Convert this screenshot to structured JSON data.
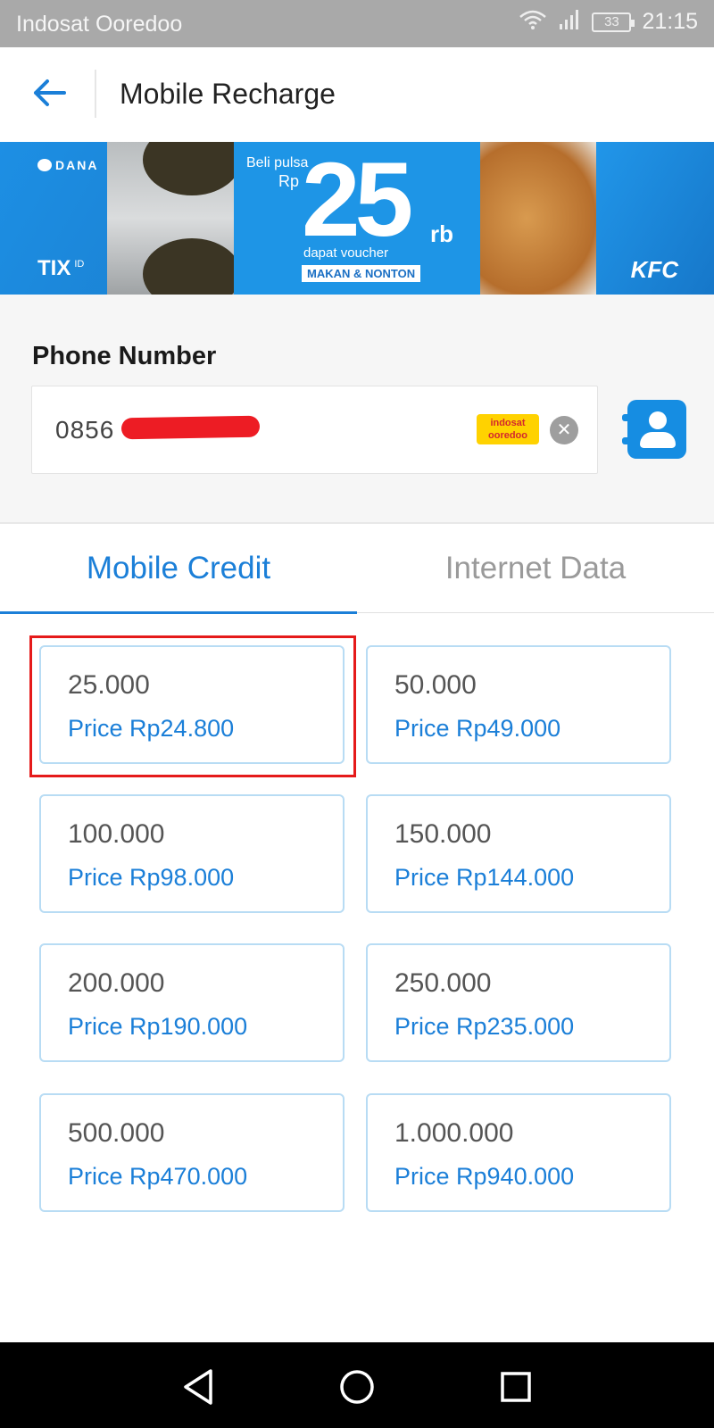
{
  "status_bar": {
    "carrier": "Indosat Ooredoo",
    "battery": "33",
    "time": "21:15"
  },
  "app_bar": {
    "title": "Mobile Recharge"
  },
  "banner": {
    "brand_left": "DANA",
    "brand_left_bottom": "TIX",
    "brand_left_bottom_sup": "ID",
    "line1": "Beli pulsa",
    "currency": "Rp",
    "amount": "25",
    "unit": "rb",
    "line2": "dapat voucher",
    "tag": "MAKAN & NONTON",
    "brand_right": "KFC"
  },
  "phone": {
    "label": "Phone Number",
    "value": "0856",
    "operator_logo": "indosat ooredoo"
  },
  "tabs": [
    {
      "label": "Mobile Credit",
      "active": true
    },
    {
      "label": "Internet Data",
      "active": false
    }
  ],
  "denominations": [
    {
      "nominal": "25.000",
      "price": "Price Rp24.800"
    },
    {
      "nominal": "50.000",
      "price": "Price Rp49.000"
    },
    {
      "nominal": "100.000",
      "price": "Price Rp98.000"
    },
    {
      "nominal": "150.000",
      "price": "Price Rp144.000"
    },
    {
      "nominal": "200.000",
      "price": "Price Rp190.000"
    },
    {
      "nominal": "250.000",
      "price": "Price Rp235.000"
    },
    {
      "nominal": "500.000",
      "price": "Price Rp470.000"
    },
    {
      "nominal": "1.000.000",
      "price": "Price Rp940.000"
    }
  ],
  "colors": {
    "accent": "#1b7fd8",
    "highlight": "#e51a1a"
  },
  "icons": {
    "back": "arrow-left-icon",
    "clear": "close-circle-icon",
    "contacts": "contact-book-icon",
    "nav_back": "triangle-back-icon",
    "nav_home": "circle-home-icon",
    "nav_recent": "square-recent-icon"
  }
}
